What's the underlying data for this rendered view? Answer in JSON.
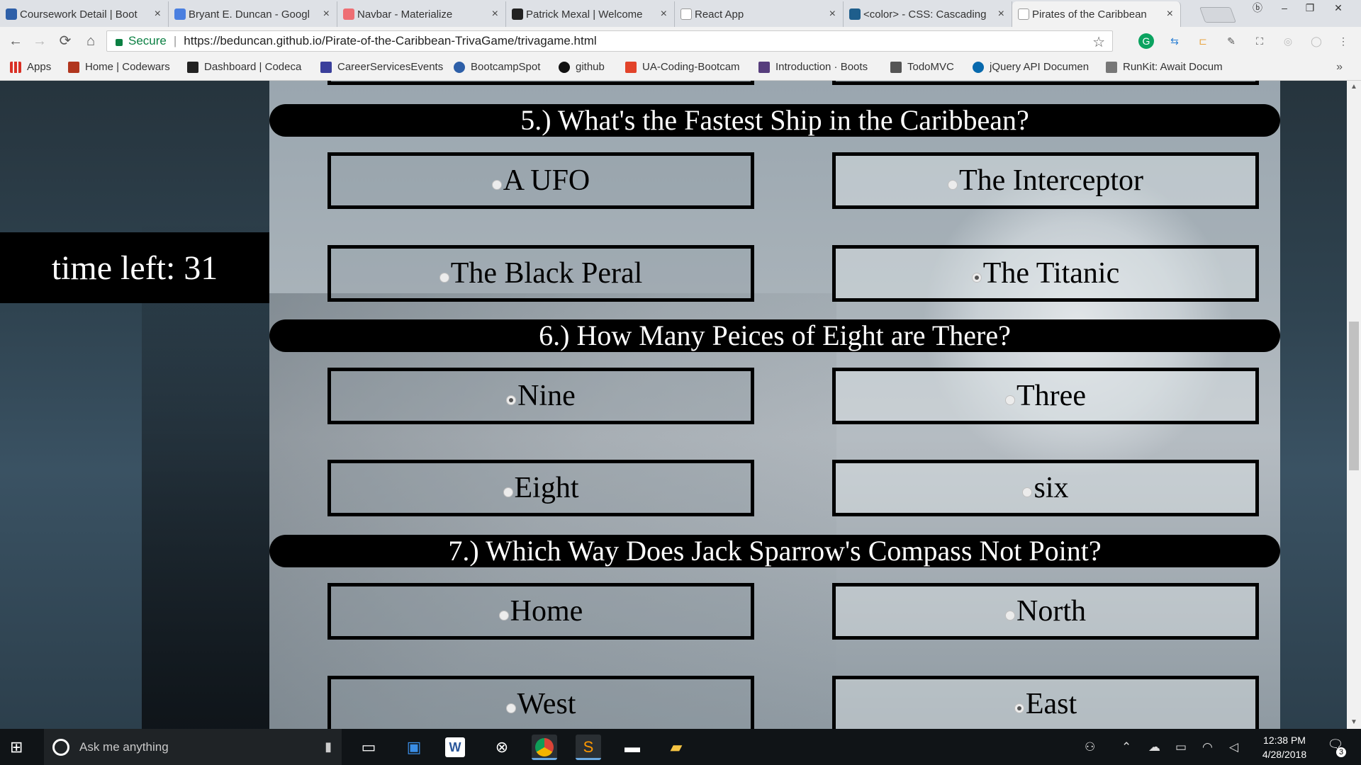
{
  "browser": {
    "tabs": [
      {
        "title": "Coursework Detail | Boot",
        "fav_color": "#2d5fa8"
      },
      {
        "title": "Bryant E. Duncan - Googl",
        "fav_color": "#4a7fe0"
      },
      {
        "title": "Navbar - Materialize",
        "fav_color": "#ee6e73"
      },
      {
        "title": "Patrick Mexal | Welcome",
        "fav_color": "#222222"
      },
      {
        "title": "React App",
        "fav_color": "#999999"
      },
      {
        "title": "<color> - CSS: Cascading",
        "fav_color": "#1e5e8c"
      },
      {
        "title": "Pirates of the Caribbean",
        "fav_color": "#e6e6e6",
        "active": true
      }
    ],
    "close_glyph": "×",
    "secure_label": "Secure",
    "url": "https://beduncan.github.io/Pirate-of-the-Caribbean-TrivaGame/trivagame.html",
    "bookmarks": [
      {
        "label": "Apps",
        "color": "#d93025"
      },
      {
        "label": "Home | Codewars",
        "color": "#b1361e"
      },
      {
        "label": "Dashboard | Codeca",
        "color": "#222222"
      },
      {
        "label": "CareerServicesEvents",
        "color": "#3a3f9b"
      },
      {
        "label": "BootcampSpot",
        "color": "#2d5fa8"
      },
      {
        "label": "github",
        "color": "#111111"
      },
      {
        "label": "UA-Coding-Bootcam",
        "color": "#e2432a"
      },
      {
        "label": "Introduction · Boots",
        "color": "#563d7c"
      },
      {
        "label": "TodoMVC",
        "color": "#555555"
      },
      {
        "label": "jQuery API Documen",
        "color": "#0769ad"
      },
      {
        "label": "RunKit: Await Docum",
        "color": "#777777"
      }
    ],
    "more_glyph": "»"
  },
  "game": {
    "timer_text": "time left: 31",
    "questions": [
      {
        "title": "5.) What's the Fastest Ship in the Caribbean?",
        "answers": [
          "A UFO",
          "The Interceptor",
          "The Black Peral",
          "The Titanic"
        ]
      },
      {
        "title": "6.) How Many Peices of Eight are There?",
        "answers": [
          "Nine",
          "Three",
          "Eight",
          "six"
        ]
      },
      {
        "title": "7.) Which Way Does Jack Sparrow's Compass Not Point?",
        "answers": [
          "Home",
          "North",
          "West",
          "East"
        ]
      }
    ]
  },
  "taskbar": {
    "search_placeholder": "Ask me anything",
    "time": "12:38 PM",
    "date": "4/28/2018",
    "notification_count": "3"
  },
  "icons": {
    "back": "←",
    "forward": "→",
    "reload": "⟳",
    "home": "⌂",
    "star": "☆",
    "windows": "⊞",
    "mic": "🎤",
    "notification": "🗨"
  }
}
